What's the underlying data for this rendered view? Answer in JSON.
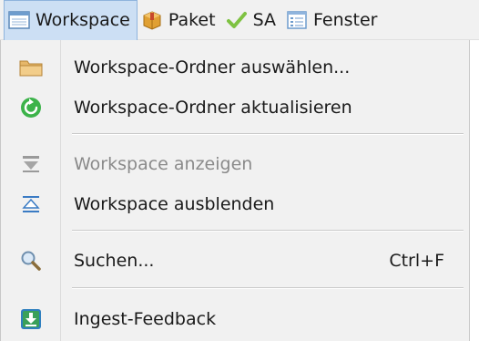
{
  "menubar": {
    "items": [
      {
        "label": "Workspace",
        "icon": "workspace-window-icon",
        "active": true
      },
      {
        "label": "Paket",
        "icon": "package-box-icon",
        "active": false
      },
      {
        "label": "SA",
        "icon": "checkmark-icon",
        "active": false
      },
      {
        "label": "Fenster",
        "icon": "window-list-icon",
        "active": false
      }
    ]
  },
  "dropdown": {
    "items": [
      {
        "label": "Workspace-Ordner auswählen...",
        "icon": "folder-icon",
        "enabled": true
      },
      {
        "label": "Workspace-Ordner aktualisieren",
        "icon": "refresh-icon",
        "enabled": true
      },
      {
        "label": "Workspace anzeigen",
        "icon": "expand-icon",
        "enabled": false
      },
      {
        "label": "Workspace ausblenden",
        "icon": "collapse-icon",
        "enabled": true
      },
      {
        "label": "Suchen...",
        "icon": "magnifier-icon",
        "enabled": true,
        "shortcut": "Ctrl+F"
      },
      {
        "label": "Ingest-Feedback",
        "icon": "ingest-download-icon",
        "enabled": true
      }
    ]
  },
  "colors": {
    "menubar_bg": "#f1f1f1",
    "active_bg": "#ccdff4",
    "active_border": "#8fb4dd",
    "disabled_text": "#8a8a8a",
    "refresh_green": "#3cb34a",
    "check_green": "#7ec242"
  }
}
